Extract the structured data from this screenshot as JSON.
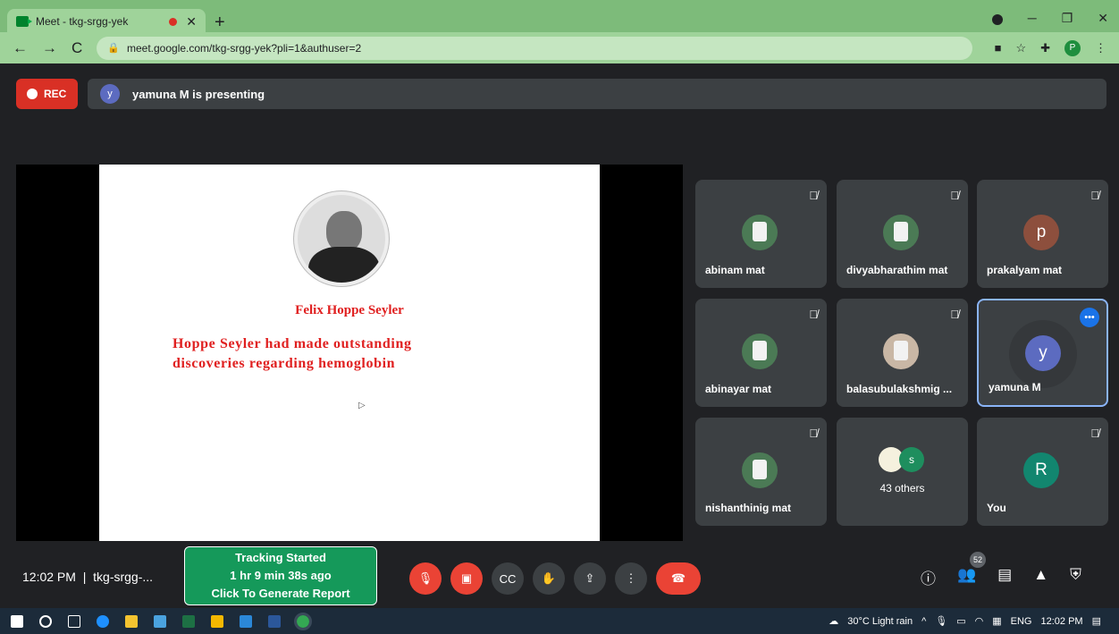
{
  "browser": {
    "tab_title": "Meet - tkg-srgg-yek",
    "url": "meet.google.com/tkg-srgg-yek?pli=1&authuser=2",
    "profile": "P"
  },
  "meet": {
    "rec_label": "REC",
    "presenter_initial": "y",
    "presenting_text": "yamuna M is presenting",
    "slide": {
      "title": "Felix Hoppe Seyler",
      "body_line1": "Hoppe Seyler had made outstanding",
      "body_line2": "discoveries regarding hemoglobin"
    },
    "participants": [
      {
        "name": "abinam mat"
      },
      {
        "name": "divyabharathim mat"
      },
      {
        "name": "prakalyam mat",
        "initial": "p"
      },
      {
        "name": "abinayar mat"
      },
      {
        "name": "balasubulakshmig ..."
      },
      {
        "name": "yamuna M",
        "initial": "y"
      },
      {
        "name": "nishanthinig mat"
      },
      {
        "name": "43 others",
        "initial": "s"
      },
      {
        "name": "You",
        "initial": "R"
      }
    ],
    "time": "12:02 PM",
    "meeting_code": "tkg-srgg-...",
    "tracker": {
      "line1": "Tracking Started",
      "line2": "1 hr 9 min 38s ago",
      "line3": "Click To Generate Report"
    },
    "people_count": "52"
  },
  "taskbar": {
    "weather": "30°C  Light rain",
    "lang": "ENG",
    "clock": "12:02 PM"
  }
}
